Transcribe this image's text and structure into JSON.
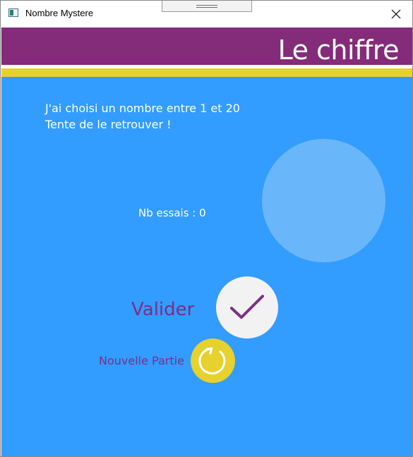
{
  "window": {
    "title": "Nombre Mystere",
    "app_icon": "window-app-icon",
    "drag_icon": "drag-handle-icon",
    "close_icon": "close-icon"
  },
  "header": {
    "title": "Le chiffre",
    "colors": {
      "band": "#842b79",
      "accent": "#e6d12e"
    }
  },
  "main": {
    "background": "#339cff",
    "intro_line1": "J'ai choisi un nombre entre 1 et 20",
    "intro_line2": "Tente de le retrouver !",
    "input_value": "",
    "tries_label": "Nb essais : ",
    "tries_count": "0",
    "validate_label": "Valider",
    "validate_icon": "checkmark-icon",
    "new_game_label": "Nouvelle Partie",
    "new_game_icon": "refresh-icon"
  }
}
